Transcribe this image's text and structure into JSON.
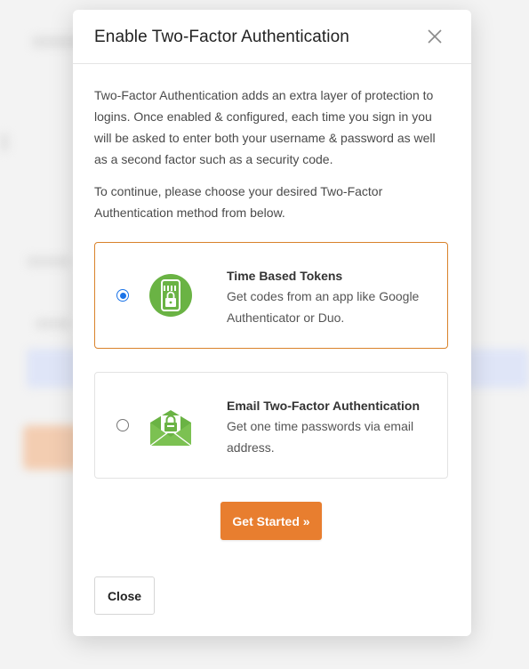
{
  "modal": {
    "title": "Enable Two-Factor Authentication",
    "intro": "Two-Factor Authentication adds an extra layer of protection to logins. Once enabled & configured, each time you sign in you will be asked to enter both your username & password as well as a second factor such as a security code.",
    "instruction": "To continue, please choose your desired Two-Factor Authentication method from below.",
    "close_icon": "close-icon"
  },
  "options": [
    {
      "title": "Time Based Tokens",
      "description": "Get codes from an app like Google Authenticator or Duo.",
      "icon": "mobile-lock-icon",
      "selected": true
    },
    {
      "title": "Email Two-Factor Authentication",
      "description": "Get one time passwords via email address.",
      "icon": "email-lock-icon",
      "selected": false
    }
  ],
  "buttons": {
    "get_started": "Get Started »",
    "close": "Close"
  },
  "colors": {
    "accent": "#e87e2f",
    "selected_border": "#d9822b",
    "radio": "#1a73e8",
    "icon_green": "#6ab344"
  }
}
